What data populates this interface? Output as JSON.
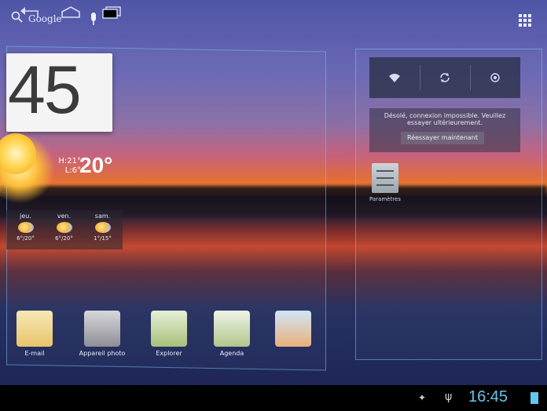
{
  "search": {
    "label": "Google"
  },
  "clock": {
    "value": "45"
  },
  "weather": {
    "high": "H:21°",
    "low": "L:6°",
    "current": "20°",
    "forecast": [
      {
        "day": "jeu.",
        "temps": "6°/20°"
      },
      {
        "day": "ven.",
        "temps": "6°/20°"
      },
      {
        "day": "sam.",
        "temps": "1°/15°"
      }
    ]
  },
  "power_control": {
    "items": [
      "wifi-icon",
      "sync-icon",
      "gps-icon"
    ]
  },
  "connection_widget": {
    "message": "Désolé, connexion impossible. Veuillez essayer ultérieurement.",
    "retry_label": "Réessayer maintenant"
  },
  "shortcuts": {
    "settings_label": "Paramètres"
  },
  "apps": [
    {
      "label": "E-mail",
      "icon": "email-icon"
    },
    {
      "label": "Appareil photo",
      "icon": "camera-icon"
    },
    {
      "label": "Explorer",
      "icon": "explorer-icon"
    },
    {
      "label": "Agenda",
      "icon": "calendar-icon"
    },
    {
      "label": "",
      "icon": "weather-app-icon"
    }
  ],
  "statusbar": {
    "time": "16:45"
  },
  "colors": {
    "accent": "#63c6ee"
  }
}
